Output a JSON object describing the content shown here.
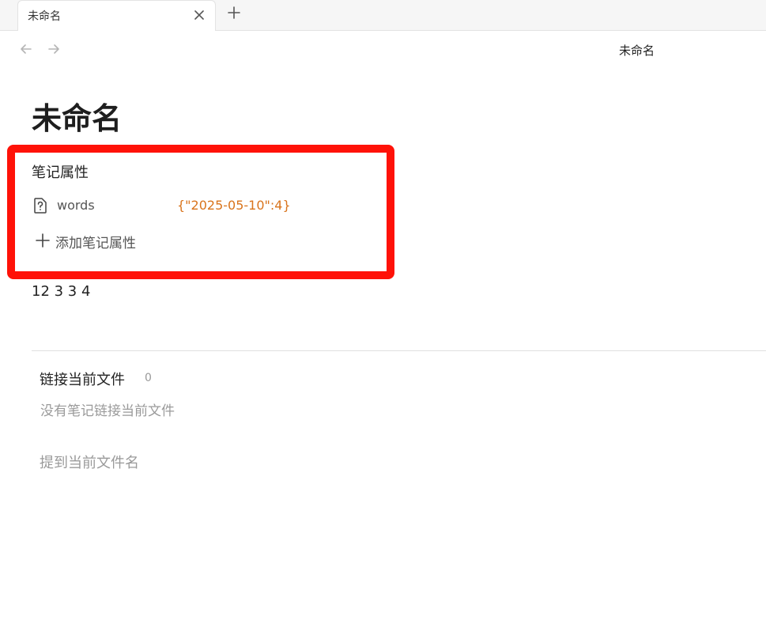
{
  "tab": {
    "title": "未命名",
    "close_icon": "close-icon",
    "new_tab_icon": "plus-icon"
  },
  "nav": {
    "back_icon": "arrow-left-icon",
    "forward_icon": "arrow-right-icon"
  },
  "header": {
    "title": "未命名"
  },
  "page": {
    "title": "未命名",
    "properties": {
      "heading": "笔记属性",
      "items": [
        {
          "icon": "unknown-file-icon",
          "key": "words",
          "value": "{\"2025-05-10\":4}"
        }
      ],
      "add_label": "添加笔记属性",
      "add_icon": "plus-icon"
    },
    "body_text": "12 3 3 4"
  },
  "backlinks": {
    "title": "链接当前文件",
    "count": "0",
    "empty_text": "没有笔记链接当前文件"
  },
  "mentions": {
    "title": "提到当前文件名"
  },
  "colors": {
    "highlight_border": "#ff1208",
    "property_value": "#d9741c"
  }
}
